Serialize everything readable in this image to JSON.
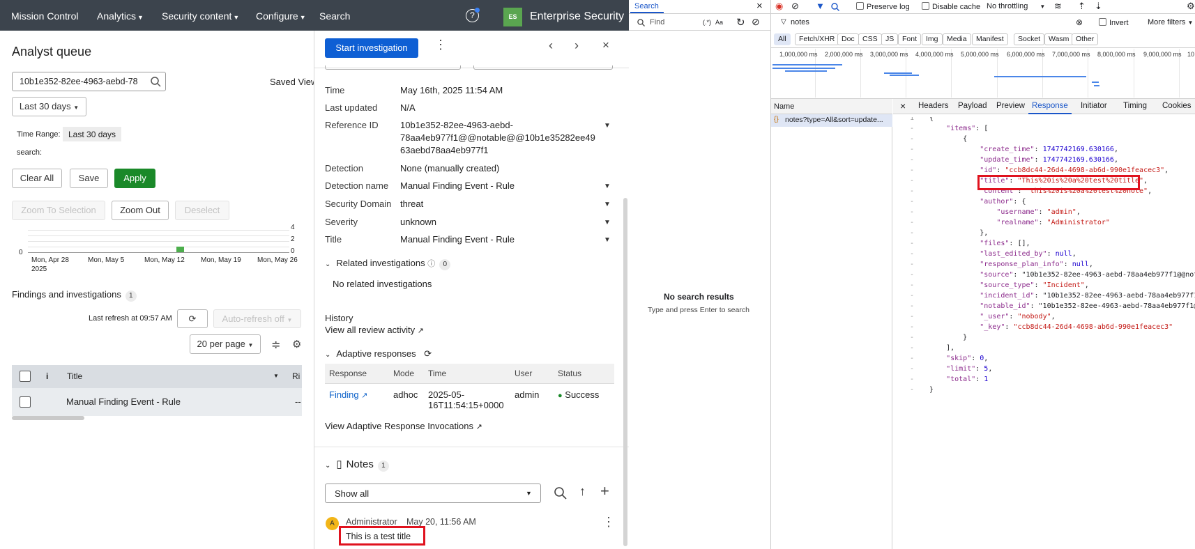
{
  "splunk": {
    "nav": {
      "items": [
        "Mission Control",
        "Analytics",
        "Security content",
        "Configure",
        "Search"
      ],
      "help_glyph": "?",
      "logo_text": "ES",
      "app_title": "Enterprise Security"
    },
    "queue": {
      "title": "Analyst queue",
      "search_value": "10b1e352-82ee-4963-aebd-78",
      "saved_views": "Saved Views",
      "time_dropdown": "Last 30 days",
      "time_range_label": "Time Range:",
      "time_range_value": "Last 30 days",
      "search_label": "search:",
      "clear_all": "Clear All",
      "save": "Save",
      "apply": "Apply",
      "zoom_to_selection": "Zoom To Selection",
      "zoom_out": "Zoom Out",
      "deselect": "Deselect",
      "chart_y_ticks": [
        "4",
        "2",
        "0"
      ],
      "chart_left_zero": "0",
      "chart_x_labels": [
        "Mon, Apr 28",
        "Mon, May 5",
        "Mon, May 12",
        "Mon, May 19",
        "Mon, May 26"
      ],
      "chart_year": "2025",
      "findings_title": "Findings and investigations",
      "findings_count": "1",
      "last_refresh": "Last refresh at 09:57 AM",
      "auto_refresh": "Auto-refresh off",
      "per_page": "20 per page",
      "table_headers": {
        "info": "i",
        "title": "Title",
        "risk": "Ri"
      },
      "row_title": "Manual Finding Event - Rule",
      "row_risk": "--"
    },
    "panel": {
      "start_investigation": "Start investigation",
      "fields": [
        {
          "label": "Time",
          "value": "May 16th, 2025 11:54 AM"
        },
        {
          "label": "Last updated",
          "value": "N/A"
        },
        {
          "label": "Reference ID",
          "value_lines": [
            "10b1e352-82ee-4963-aebd-",
            "78aa4eb977f1@@notable@@10b1e35282ee49",
            "63aebd78aa4eb977f1"
          ]
        },
        {
          "label": "Detection",
          "value": "None (manually created)"
        },
        {
          "label": "Detection name",
          "value": "Manual Finding Event - Rule"
        },
        {
          "label": "Security Domain",
          "value": "threat"
        },
        {
          "label": "Severity",
          "value": "unknown"
        },
        {
          "label": "Title",
          "value": "Manual Finding Event - Rule"
        }
      ],
      "related_title": "Related investigations",
      "related_count": "0",
      "no_related": "No related investigations",
      "history": "History",
      "view_review": "View all review activity",
      "adaptive_title": "Adaptive responses",
      "ar_headers": [
        "Response",
        "Mode",
        "Time",
        "User",
        "Status"
      ],
      "ar_row": {
        "response": "Finding",
        "mode": "adhoc",
        "time_l1": "2025-05-",
        "time_l2": "16T11:54:15+0000",
        "user": "admin",
        "status": "Success"
      },
      "view_invocations": "View Adaptive Response Invocations",
      "notes_title": "Notes",
      "notes_count": "1",
      "notes_filter": "Show all",
      "note_avatar": "A",
      "note_author": "Administrator",
      "note_date": "May 20, 11:56 AM",
      "note_title": "This is a test title"
    }
  },
  "search_pane": {
    "tab": "Search",
    "find_placeholder": "Find",
    "regex": "(.*)",
    "case": "Aa",
    "no_results": "No search results",
    "hint": "Type and press Enter to search"
  },
  "network": {
    "preserve_log": "Preserve log",
    "disable_cache": "Disable cache",
    "throttling": "No throttling",
    "filter_value": "notes",
    "invert": "Invert",
    "more_filters": "More filters",
    "types": [
      "All",
      "Fetch/XHR",
      "Doc",
      "CSS",
      "JS",
      "Font",
      "Img",
      "Media",
      "Manifest",
      "Socket",
      "Wasm",
      "Other"
    ],
    "timeline_labels": [
      "1,000,000 ms",
      "2,000,000 ms",
      "3,000,000 ms",
      "4,000,000 ms",
      "5,000,000 ms",
      "6,000,000 ms",
      "7,000,000 ms",
      "8,000,000 ms",
      "9,000,000 ms",
      "10"
    ],
    "name_header": "Name",
    "request_name": "notes?type=All&sort=update...",
    "tabs": [
      "Headers",
      "Payload",
      "Preview",
      "Response",
      "Initiator",
      "Timing",
      "Cookies"
    ],
    "active_tab": "Response",
    "code": [
      {
        "g": "1",
        "t": "{"
      },
      {
        "g": "-",
        "t": "    \"items\": ["
      },
      {
        "g": "-",
        "t": "        {"
      },
      {
        "g": "-",
        "t": "            \"create_time\": 1747742169.630166,"
      },
      {
        "g": "-",
        "t": "            \"update_time\": 1747742169.630166,"
      },
      {
        "g": "-",
        "t": "            \"id\": \"ccb8dc44-26d4-4698-ab6d-990e1feacec3\","
      },
      {
        "g": "-",
        "t": "            \"title\": \"This%20is%20a%20test%20title\","
      },
      {
        "g": "-",
        "t": "            \"content\": \"this%20is%20a%20test%20note\","
      },
      {
        "g": "-",
        "t": "            \"author\": {"
      },
      {
        "g": "-",
        "t": "                \"username\": \"admin\","
      },
      {
        "g": "-",
        "t": "                \"realname\": \"Administrator\""
      },
      {
        "g": "-",
        "t": "            },"
      },
      {
        "g": "-",
        "t": "            \"files\": [],"
      },
      {
        "g": "-",
        "t": "            \"last_edited_by\": null,"
      },
      {
        "g": "-",
        "t": "            \"response_plan_info\": null,"
      },
      {
        "g": "-",
        "t": "            \"source\": \"10b1e352-82ee-4963-aebd-78aa4eb977f1@@notable@@10b1e"
      },
      {
        "g": "-",
        "t": "            \"source_type\": \"Incident\","
      },
      {
        "g": "-",
        "t": "            \"incident_id\": \"10b1e352-82ee-4963-aebd-78aa4eb977f1@@notable@@"
      },
      {
        "g": "-",
        "t": "            \"notable_id\": \"10b1e352-82ee-4963-aebd-78aa4eb977f1@@notable@@1"
      },
      {
        "g": "-",
        "t": "            \"_user\": \"nobody\","
      },
      {
        "g": "-",
        "t": "            \"_key\": \"ccb8dc44-26d4-4698-ab6d-990e1feacec3\""
      },
      {
        "g": "-",
        "t": "        }"
      },
      {
        "g": "-",
        "t": "    ],"
      },
      {
        "g": "-",
        "t": "    \"skip\": 0,"
      },
      {
        "g": "-",
        "t": "    \"limit\": 5,"
      },
      {
        "g": "-",
        "t": "    \"total\": 1"
      },
      {
        "g": "-",
        "t": "}"
      }
    ]
  },
  "colors": {
    "nav_bg": "#3c444d",
    "primary_blue": "#0e5fd4",
    "apply_green": "#1a8929",
    "highlight_red": "#e0121e",
    "devtools_blue": "#1a56c9"
  }
}
